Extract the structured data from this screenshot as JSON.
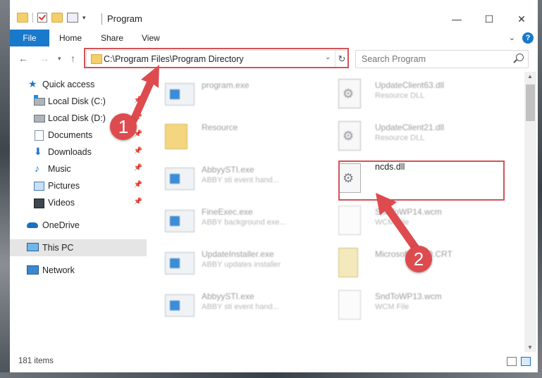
{
  "window": {
    "title": "Program",
    "controls": {
      "minimize": "—",
      "maximize": "☐",
      "close": "✕"
    }
  },
  "ribbon": {
    "tabs": [
      "File",
      "Home",
      "Share",
      "View"
    ],
    "help": "?"
  },
  "address_bar": {
    "path": "C:\\Program Files\\Program Directory"
  },
  "search": {
    "placeholder": "Search Program"
  },
  "sidebar": {
    "items": [
      {
        "label": "Quick access",
        "icon": "star-icon"
      },
      {
        "label": "Local Disk (C:)",
        "icon": "disk-icon",
        "pinned": true
      },
      {
        "label": "Local Disk (D:)",
        "icon": "disk-icon",
        "pinned": true
      },
      {
        "label": "Documents",
        "icon": "documents-icon",
        "pinned": true
      },
      {
        "label": "Downloads",
        "icon": "download-icon",
        "pinned": true
      },
      {
        "label": "Music",
        "icon": "music-icon",
        "pinned": true
      },
      {
        "label": "Pictures",
        "icon": "pictures-icon",
        "pinned": true
      },
      {
        "label": "Videos",
        "icon": "videos-icon",
        "pinned": true
      },
      {
        "label": "OneDrive",
        "icon": "cloud-icon"
      },
      {
        "label": "This PC",
        "icon": "computer-icon",
        "selected": true
      },
      {
        "label": "Network",
        "icon": "network-icon"
      }
    ]
  },
  "files": [
    {
      "name": "program.exe",
      "sub": "",
      "icon": "app-icon"
    },
    {
      "name": "UpdateClient63.dll",
      "sub": "Resource DLL",
      "icon": "dll-icon"
    },
    {
      "name": "Resource",
      "sub": "",
      "icon": "folder-icon"
    },
    {
      "name": "UpdateClient21.dll",
      "sub": "Resource DLL",
      "icon": "dll-icon"
    },
    {
      "name": "AbbyySTI.exe",
      "sub": "ABBY sti event hand...",
      "icon": "app-icon"
    },
    {
      "name": "ncds.dll",
      "sub": "",
      "icon": "dll-gear-icon"
    },
    {
      "name": "FineExec.exe",
      "sub": "ABBY background exe...",
      "icon": "app-icon"
    },
    {
      "name": "SndToWP14.wcm",
      "sub": "WCM File",
      "icon": "document-icon"
    },
    {
      "name": "UpdateInstaller.exe",
      "sub": "ABBY updates installer",
      "icon": "installer-icon"
    },
    {
      "name": "Microsoft.VC80.CRT",
      "sub": "",
      "icon": "crt-icon"
    },
    {
      "name": "AbbyySTI.exe",
      "sub": "ABBY sti event hand...",
      "icon": "app-icon"
    },
    {
      "name": "SndToWP13.wcm",
      "sub": "WCM File",
      "icon": "document-icon"
    }
  ],
  "status": {
    "item_count": "181 items"
  },
  "annotations": {
    "step1": "1",
    "step2": "2",
    "color": "#de4b4f"
  }
}
